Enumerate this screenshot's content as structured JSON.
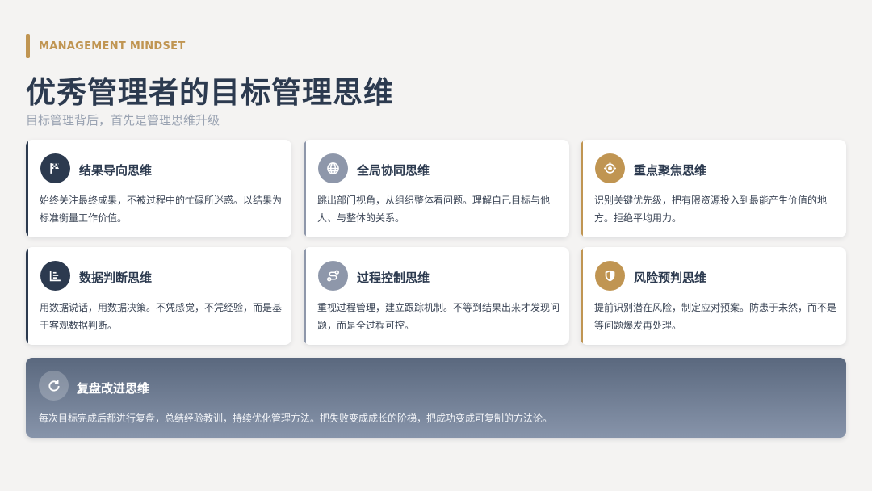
{
  "header": {
    "kicker": "MANAGEMENT MINDSET",
    "title": "优秀管理者的目标管理思维",
    "subtitle": "目标管理背后，首先是管理思维升级"
  },
  "colors": {
    "navy": "#2c3a4f",
    "slate": "#8e97aa",
    "gold": "#c09552",
    "background": "#f4f3f2"
  },
  "cards": [
    {
      "title": "结果导向思维",
      "desc": "始终关注最终成果，不被过程中的忙碌所迷惑。以结果为标准衡量工作价值。",
      "icon": "flag-icon",
      "accent": "#2c3a4f"
    },
    {
      "title": "全局协同思维",
      "desc": "跳出部门视角，从组织整体看问题。理解自己目标与他人、与整体的关系。",
      "icon": "globe-icon",
      "accent": "#8e97aa"
    },
    {
      "title": "重点聚焦思维",
      "desc": "识别关键优先级，把有限资源投入到最能产生价值的地方。拒绝平均用力。",
      "icon": "crosshair-icon",
      "accent": "#c09552"
    },
    {
      "title": "数据判断思维",
      "desc": "用数据说话，用数据决策。不凭感觉，不凭经验，而是基于客观数据判断。",
      "icon": "chart-icon",
      "accent": "#2c3a4f"
    },
    {
      "title": "过程控制思维",
      "desc": "重视过程管理，建立跟踪机制。不等到结果出来才发现问题，而是全过程可控。",
      "icon": "route-icon",
      "accent": "#8e97aa"
    },
    {
      "title": "风险预判思维",
      "desc": "提前识别潜在风险，制定应对预案。防患于未然，而不是等问题爆发再处理。",
      "icon": "shield-icon",
      "accent": "#c09552"
    }
  ],
  "banner": {
    "title": "复盘改进思维",
    "desc": "每次目标完成后都进行复盘，总结经验教训，持续优化管理方法。把失败变成成长的阶梯，把成功变成可复制的方法论。",
    "icon": "refresh-icon"
  }
}
